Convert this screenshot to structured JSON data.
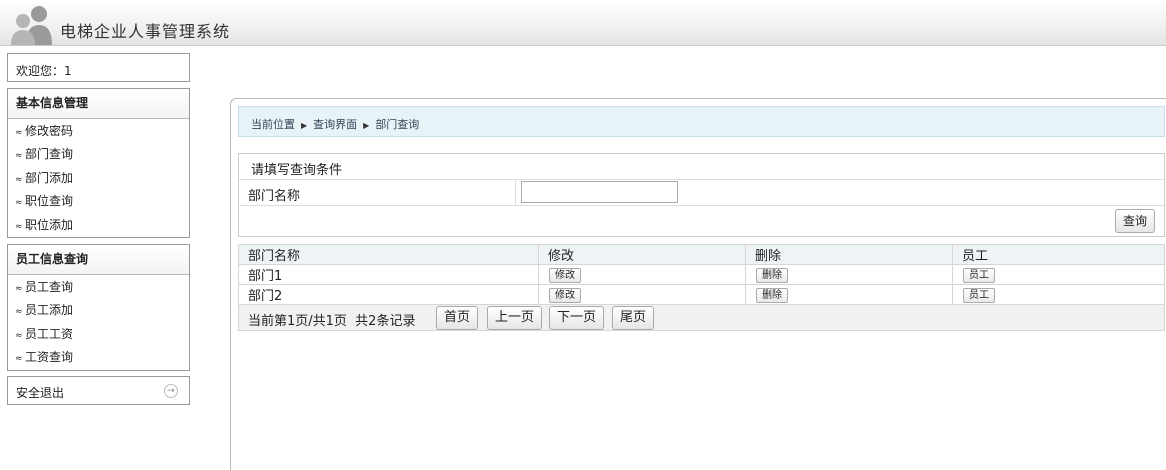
{
  "app": {
    "title": "电梯企业人事管理系统"
  },
  "sidebar": {
    "welcome": "欢迎您：1",
    "groups": [
      {
        "title": "基本信息管理",
        "items": [
          "修改密码",
          "部门查询",
          "部门添加",
          "职位查询",
          "职位添加"
        ]
      },
      {
        "title": "员工信息查询",
        "items": [
          "员工查询",
          "员工添加",
          "员工工资",
          "工资查询"
        ]
      }
    ],
    "logout": "安全退出"
  },
  "breadcrumb": [
    "当前位置",
    "查询界面",
    "部门查询"
  ],
  "query": {
    "heading": "请填写查询条件",
    "field_label": "部门名称",
    "field_value": "",
    "submit": "查询"
  },
  "table": {
    "columns": [
      "部门名称",
      "修改",
      "删除",
      "员工"
    ],
    "rows": [
      {
        "name": "部门1",
        "edit": "修改",
        "delete": "删除",
        "staff": "员工"
      },
      {
        "name": "部门2",
        "edit": "修改",
        "delete": "删除",
        "staff": "员工"
      }
    ]
  },
  "pager": {
    "info": "当前第1页/共1页  共2条记录",
    "first": "首页",
    "prev": "上一页",
    "next": "下一页",
    "last": "尾页"
  }
}
